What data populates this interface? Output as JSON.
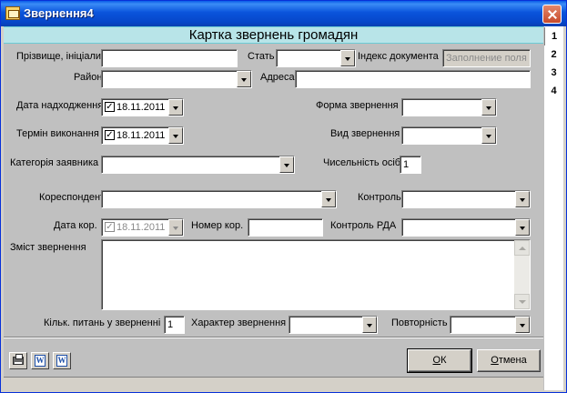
{
  "window": {
    "title": "Звернення4",
    "close_glyph": "✕"
  },
  "header": {
    "title": "Картка звернень громадян"
  },
  "tabs": [
    "1",
    "2",
    "3",
    "4"
  ],
  "labels": {
    "pib": "Прізвище, ініціали",
    "sex": "Стать",
    "index": "Індекс документа",
    "district": "Район",
    "address": "Адреса",
    "date_received": "Дата надходження",
    "appeal_form": "Форма звернення",
    "deadline": "Термін виконання",
    "appeal_kind": "Вид звернення",
    "applicant_category": "Категорія заявника",
    "persons_count": "Чисельність осіб",
    "correspondent": "Кореспондент",
    "control": "Контроль",
    "date_kor": "Дата кор.",
    "number_kor": "Номер кор.",
    "control_rda": "Контроль РДА",
    "content": "Зміст звернення",
    "questions_count": "Кільк. питань у зверненні",
    "appeal_character": "Характер звернення",
    "repeat": "Повторність"
  },
  "values": {
    "index_placeholder": "Заполнение поля",
    "date_received": "18.11.2011",
    "deadline": "18.11.2011",
    "persons_count": "1",
    "date_kor": "18.11.2011",
    "questions_count": "1",
    "checkbox_mark": "✓"
  },
  "buttons": {
    "ok_prefix": "",
    "ok_accel": "О",
    "ok_rest": "К",
    "cancel_accel": "О",
    "cancel_rest": "тмена"
  },
  "toolbar": {
    "word_glyph": "W"
  },
  "icons": [
    "printer-icon",
    "word-icon",
    "word-icon",
    "close-icon",
    "chevron-down-icon"
  ],
  "colors": {
    "titlebar": "#0a54dc",
    "header_band": "#b8e4e8",
    "panel": "#c0c0c0"
  }
}
